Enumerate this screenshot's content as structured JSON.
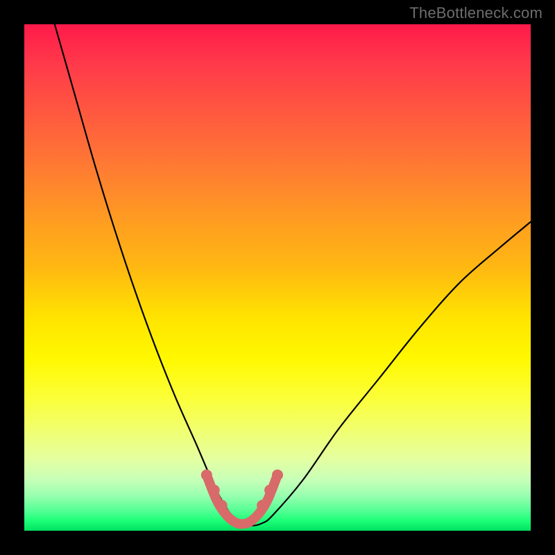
{
  "watermark": "TheBottleneck.com",
  "colors": {
    "background": "#000000",
    "curve": "#000000",
    "highlight": "#d86a6a",
    "gradient_top": "#ff1a4a",
    "gradient_mid": "#ffe400",
    "gradient_bottom": "#00e060"
  },
  "chart_data": {
    "type": "line",
    "title": "",
    "xlabel": "",
    "ylabel": "",
    "xlim": [
      0,
      100
    ],
    "ylim": [
      0,
      100
    ],
    "grid": false,
    "legend": false,
    "series": [
      {
        "name": "bottleneck-curve",
        "x": [
          6,
          10,
          14,
          18,
          22,
          26,
          30,
          34,
          37,
          39,
          41,
          43,
          45,
          47,
          49,
          55,
          62,
          70,
          78,
          86,
          94,
          100
        ],
        "y": [
          100,
          86,
          72,
          59,
          47,
          36,
          26,
          17,
          10,
          6,
          3,
          1.5,
          1,
          1.5,
          3,
          10,
          20,
          30,
          40,
          49,
          56,
          61
        ]
      },
      {
        "name": "highlight-band",
        "x": [
          36,
          38,
          40,
          42,
          44,
          46,
          48,
          50
        ],
        "y": [
          11,
          6,
          3,
          1.5,
          1.5,
          3,
          6,
          11
        ]
      }
    ],
    "highlight_dots": {
      "x": [
        36,
        37.5,
        39,
        47,
        48.5,
        50
      ],
      "y": [
        11,
        8,
        5,
        5,
        8,
        11
      ]
    }
  }
}
